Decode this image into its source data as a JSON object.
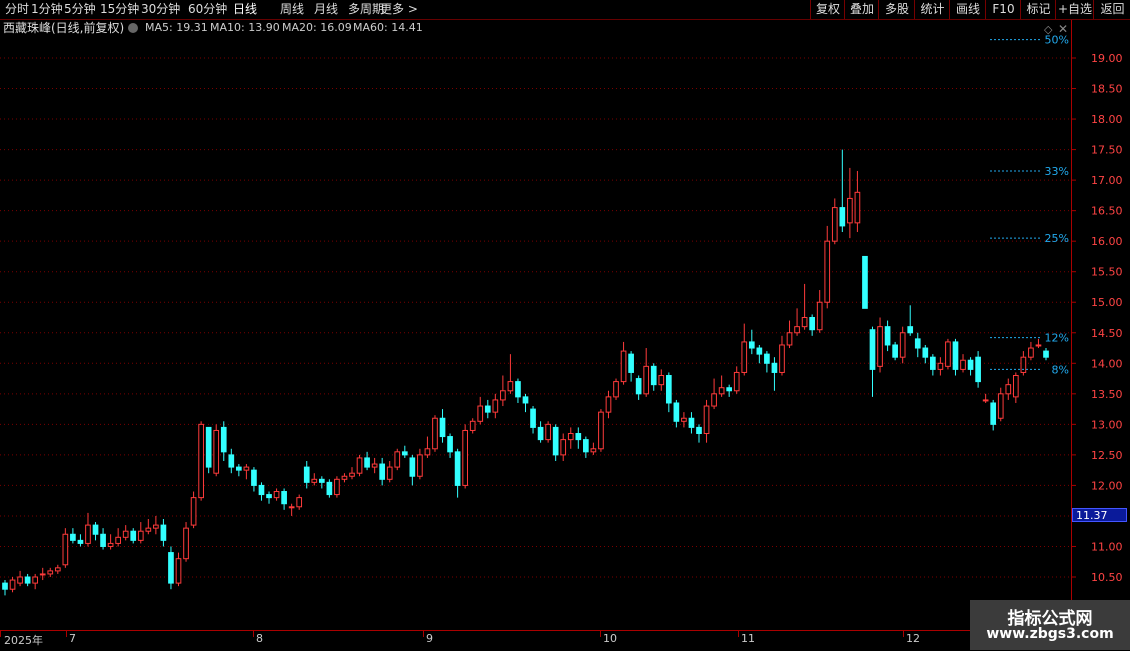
{
  "topbar": {
    "tabs": [
      "分时",
      "1分钟",
      "5分钟",
      "15分钟",
      "30分钟",
      "60分钟",
      "日线",
      "周线",
      "月线",
      "多周期",
      "更多 >"
    ],
    "active_tab": "日线",
    "right_buttons": [
      "复权",
      "叠加",
      "多股",
      "统计",
      "画线",
      "F10",
      "标记",
      "+自选",
      "返回"
    ]
  },
  "info": {
    "stock_name": "西藏珠峰(日线,前复权)",
    "ma5": "MA5: 19.31",
    "ma10": "MA10: 13.90",
    "ma20": "MA20: 16.09",
    "ma60": "MA60: 14.41"
  },
  "colors": {
    "up": "#ff3b3b",
    "down": "#33ffff",
    "grid": "#7a0000",
    "axis": "#aa0000",
    "ma": "#22aaee",
    "pct": "#22aaee"
  },
  "yaxis": {
    "ticks": [
      "19.00",
      "18.50",
      "18.00",
      "17.50",
      "17.00",
      "16.50",
      "16.00",
      "15.50",
      "15.00",
      "14.50",
      "14.00",
      "13.50",
      "13.00",
      "12.50",
      "12.00",
      "11.50",
      "11.00",
      "10.50"
    ]
  },
  "xaxis": {
    "labels": [
      "2025年",
      "7",
      "8",
      "9",
      "10",
      "11",
      "12"
    ]
  },
  "price_tag": "11.37",
  "pct_lines": [
    "50%",
    "33%",
    "25%",
    "12%",
    "8%"
  ],
  "watermark": {
    "title": "指标公式网",
    "url": "www.zbgs3.com"
  },
  "chart_data": {
    "type": "candlestick",
    "ylim": [
      10.25,
      19.3
    ],
    "candles": [
      [
        10.4,
        10.3,
        10.45,
        10.2
      ],
      [
        10.3,
        10.45,
        10.5,
        10.25
      ],
      [
        10.4,
        10.5,
        10.6,
        10.35
      ],
      [
        10.5,
        10.4,
        10.55,
        10.35
      ],
      [
        10.4,
        10.5,
        10.55,
        10.3
      ],
      [
        10.55,
        10.55,
        10.65,
        10.45
      ],
      [
        10.55,
        10.6,
        10.65,
        10.5
      ],
      [
        10.6,
        10.65,
        10.7,
        10.55
      ],
      [
        10.7,
        11.2,
        11.3,
        10.65
      ],
      [
        11.2,
        11.1,
        11.3,
        11.05
      ],
      [
        11.1,
        11.05,
        11.2,
        11.0
      ],
      [
        11.05,
        11.35,
        11.55,
        11.0
      ],
      [
        11.35,
        11.2,
        11.4,
        11.1
      ],
      [
        11.2,
        11.0,
        11.3,
        10.95
      ],
      [
        11.0,
        11.05,
        11.2,
        10.95
      ],
      [
        11.05,
        11.15,
        11.3,
        11.0
      ],
      [
        11.15,
        11.25,
        11.35,
        11.1
      ],
      [
        11.25,
        11.1,
        11.3,
        11.05
      ],
      [
        11.1,
        11.25,
        11.4,
        11.05
      ],
      [
        11.25,
        11.3,
        11.45,
        11.2
      ],
      [
        11.3,
        11.35,
        11.5,
        11.2
      ],
      [
        11.35,
        11.1,
        11.45,
        11.0
      ],
      [
        10.9,
        10.4,
        11.0,
        10.3
      ],
      [
        10.4,
        10.8,
        10.9,
        10.35
      ],
      [
        10.8,
        11.3,
        11.4,
        10.75
      ],
      [
        11.35,
        11.8,
        11.9,
        11.3
      ],
      [
        11.8,
        13.0,
        13.05,
        11.75
      ],
      [
        12.95,
        12.3,
        12.95,
        12.2
      ],
      [
        12.2,
        12.9,
        13.0,
        12.15
      ],
      [
        12.95,
        12.55,
        13.05,
        12.4
      ],
      [
        12.5,
        12.3,
        12.6,
        12.2
      ],
      [
        12.3,
        12.25,
        12.35,
        12.15
      ],
      [
        12.25,
        12.3,
        12.35,
        12.1
      ],
      [
        12.25,
        12.0,
        12.3,
        11.9
      ],
      [
        12.0,
        11.85,
        12.05,
        11.75
      ],
      [
        11.85,
        11.8,
        11.9,
        11.7
      ],
      [
        11.8,
        11.9,
        11.95,
        11.75
      ],
      [
        11.9,
        11.7,
        11.95,
        11.6
      ],
      [
        11.65,
        11.65,
        11.7,
        11.5
      ],
      [
        11.65,
        11.8,
        11.85,
        11.6
      ],
      [
        12.3,
        12.05,
        12.4,
        11.95
      ],
      [
        12.05,
        12.1,
        12.2,
        12.0
      ],
      [
        12.1,
        12.05,
        12.15,
        11.95
      ],
      [
        12.05,
        11.85,
        12.1,
        11.8
      ],
      [
        11.85,
        12.1,
        12.15,
        11.8
      ],
      [
        12.1,
        12.15,
        12.2,
        12.05
      ],
      [
        12.15,
        12.2,
        12.3,
        12.1
      ],
      [
        12.2,
        12.45,
        12.5,
        12.15
      ],
      [
        12.45,
        12.3,
        12.55,
        12.25
      ],
      [
        12.3,
        12.35,
        12.45,
        12.2
      ],
      [
        12.35,
        12.1,
        12.45,
        12.0
      ],
      [
        12.1,
        12.3,
        12.4,
        12.05
      ],
      [
        12.3,
        12.55,
        12.6,
        12.25
      ],
      [
        12.55,
        12.5,
        12.65,
        12.45
      ],
      [
        12.45,
        12.15,
        12.5,
        12.0
      ],
      [
        12.15,
        12.5,
        12.6,
        12.1
      ],
      [
        12.5,
        12.6,
        12.8,
        12.45
      ],
      [
        12.6,
        13.1,
        13.15,
        12.55
      ],
      [
        13.1,
        12.8,
        13.25,
        12.7
      ],
      [
        12.8,
        12.55,
        12.85,
        12.45
      ],
      [
        12.55,
        12.0,
        12.6,
        11.8
      ],
      [
        12.0,
        12.9,
        13.0,
        11.95
      ],
      [
        12.9,
        13.05,
        13.1,
        12.85
      ],
      [
        13.05,
        13.3,
        13.45,
        13.0
      ],
      [
        13.3,
        13.2,
        13.4,
        13.1
      ],
      [
        13.2,
        13.4,
        13.5,
        13.1
      ],
      [
        13.4,
        13.55,
        13.8,
        13.3
      ],
      [
        13.55,
        13.7,
        14.15,
        13.5
      ],
      [
        13.7,
        13.45,
        13.75,
        13.35
      ],
      [
        13.45,
        13.35,
        13.5,
        13.2
      ],
      [
        13.25,
        12.95,
        13.3,
        12.85
      ],
      [
        12.95,
        12.75,
        13.05,
        12.7
      ],
      [
        12.75,
        13.0,
        13.05,
        12.7
      ],
      [
        12.95,
        12.5,
        13.0,
        12.4
      ],
      [
        12.5,
        12.75,
        12.85,
        12.4
      ],
      [
        12.75,
        12.85,
        12.95,
        12.6
      ],
      [
        12.85,
        12.75,
        12.95,
        12.6
      ],
      [
        12.75,
        12.55,
        12.8,
        12.45
      ],
      [
        12.55,
        12.6,
        12.7,
        12.5
      ],
      [
        12.6,
        13.2,
        13.25,
        12.55
      ],
      [
        13.2,
        13.45,
        13.55,
        13.1
      ],
      [
        13.45,
        13.7,
        13.75,
        13.4
      ],
      [
        13.7,
        14.2,
        14.35,
        13.65
      ],
      [
        14.15,
        13.85,
        14.2,
        13.7
      ],
      [
        13.75,
        13.5,
        13.8,
        13.4
      ],
      [
        13.5,
        13.95,
        14.25,
        13.45
      ],
      [
        13.95,
        13.65,
        14.0,
        13.55
      ],
      [
        13.65,
        13.8,
        13.9,
        13.55
      ],
      [
        13.8,
        13.35,
        13.85,
        13.2
      ],
      [
        13.35,
        13.05,
        13.4,
        12.95
      ],
      [
        13.05,
        13.1,
        13.2,
        12.95
      ],
      [
        13.1,
        12.95,
        13.2,
        12.85
      ],
      [
        12.95,
        12.85,
        13.0,
        12.7
      ],
      [
        12.85,
        13.3,
        13.4,
        12.7
      ],
      [
        13.3,
        13.5,
        13.75,
        13.25
      ],
      [
        13.5,
        13.6,
        13.8,
        13.45
      ],
      [
        13.6,
        13.55,
        13.65,
        13.45
      ],
      [
        13.55,
        13.85,
        13.95,
        13.5
      ],
      [
        13.85,
        14.35,
        14.65,
        13.8
      ],
      [
        14.35,
        14.25,
        14.55,
        14.15
      ],
      [
        14.25,
        14.15,
        14.3,
        14.0
      ],
      [
        14.15,
        14.0,
        14.2,
        13.85
      ],
      [
        14.0,
        13.85,
        14.1,
        13.55
      ],
      [
        13.85,
        14.3,
        14.45,
        13.8
      ],
      [
        14.3,
        14.5,
        14.7,
        14.25
      ],
      [
        14.5,
        14.6,
        14.9,
        14.45
      ],
      [
        14.6,
        14.75,
        15.3,
        14.55
      ],
      [
        14.75,
        14.55,
        14.8,
        14.45
      ],
      [
        14.55,
        15.0,
        15.2,
        14.5
      ],
      [
        15.0,
        16.0,
        16.25,
        14.9
      ],
      [
        16.0,
        16.55,
        16.7,
        15.95
      ],
      [
        16.55,
        16.25,
        17.5,
        16.15
      ],
      [
        16.3,
        16.7,
        17.2,
        16.05
      ],
      [
        16.3,
        16.8,
        17.15,
        16.15
      ],
      [
        15.75,
        14.9,
        15.75,
        14.9
      ],
      [
        14.55,
        13.9,
        14.6,
        13.45
      ],
      [
        13.95,
        14.6,
        14.75,
        13.85
      ],
      [
        14.6,
        14.3,
        14.7,
        14.2
      ],
      [
        14.3,
        14.1,
        14.35,
        14.05
      ],
      [
        14.1,
        14.5,
        14.6,
        14.0
      ],
      [
        14.6,
        14.5,
        14.95,
        14.45
      ],
      [
        14.4,
        14.25,
        14.5,
        14.1
      ],
      [
        14.25,
        14.1,
        14.3,
        14.0
      ],
      [
        14.1,
        13.9,
        14.15,
        13.8
      ],
      [
        13.9,
        14.0,
        14.1,
        13.8
      ],
      [
        13.95,
        14.35,
        14.4,
        13.9
      ],
      [
        14.35,
        13.9,
        14.4,
        13.8
      ],
      [
        13.9,
        14.05,
        14.15,
        13.85
      ],
      [
        14.05,
        13.9,
        14.1,
        13.8
      ],
      [
        14.1,
        13.7,
        14.2,
        13.6
      ],
      [
        13.4,
        13.4,
        13.5,
        13.35
      ],
      [
        13.35,
        13.0,
        13.4,
        12.9
      ],
      [
        13.1,
        13.5,
        13.6,
        13.05
      ],
      [
        13.5,
        13.65,
        13.75,
        13.4
      ],
      [
        13.45,
        13.8,
        13.85,
        13.35
      ],
      [
        13.85,
        14.1,
        14.2,
        13.8
      ],
      [
        14.1,
        14.25,
        14.35,
        14.05
      ],
      [
        14.3,
        14.3,
        14.4,
        14.25
      ],
      [
        14.2,
        14.1,
        14.25,
        14.05
      ]
    ]
  }
}
